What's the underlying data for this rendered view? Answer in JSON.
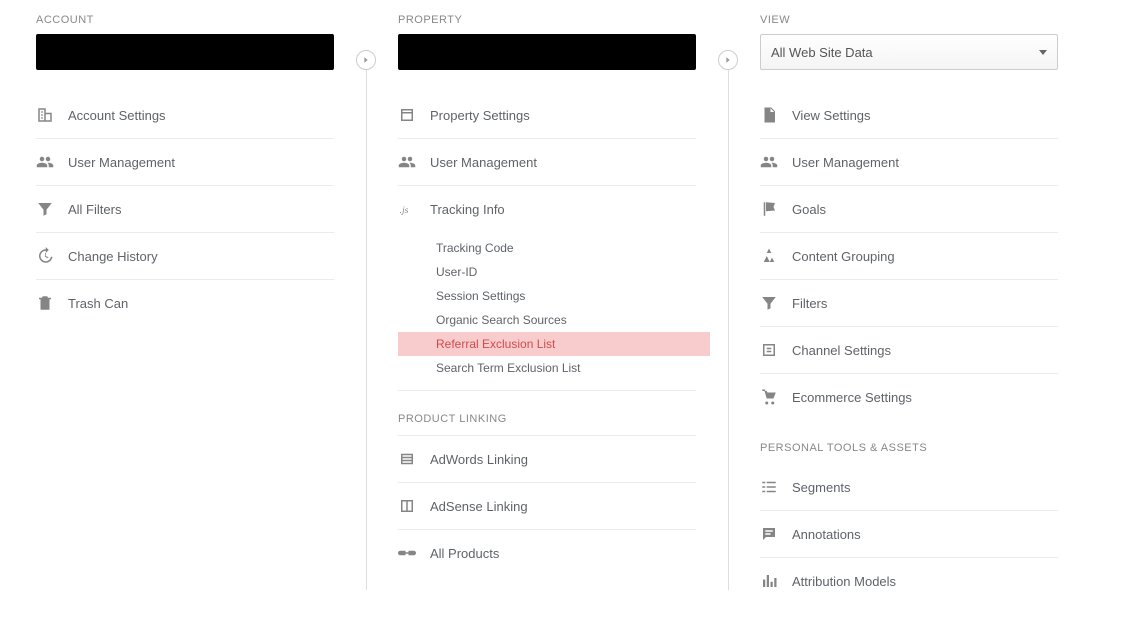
{
  "account": {
    "label": "ACCOUNT",
    "items": [
      {
        "id": "account-settings",
        "label": "Account Settings"
      },
      {
        "id": "user-management",
        "label": "User Management"
      },
      {
        "id": "all-filters",
        "label": "All Filters"
      },
      {
        "id": "change-history",
        "label": "Change History"
      },
      {
        "id": "trash-can",
        "label": "Trash Can"
      }
    ]
  },
  "property": {
    "label": "PROPERTY",
    "items": [
      {
        "id": "property-settings",
        "label": "Property Settings"
      },
      {
        "id": "user-management",
        "label": "User Management"
      },
      {
        "id": "tracking-info",
        "label": "Tracking Info"
      }
    ],
    "tracking_sub": [
      {
        "id": "tracking-code",
        "label": "Tracking Code"
      },
      {
        "id": "user-id",
        "label": "User-ID"
      },
      {
        "id": "session-settings",
        "label": "Session Settings"
      },
      {
        "id": "organic-search-sources",
        "label": "Organic Search Sources"
      },
      {
        "id": "referral-exclusion",
        "label": "Referral Exclusion List",
        "highlight": true
      },
      {
        "id": "search-term-exclusion",
        "label": "Search Term Exclusion List"
      }
    ],
    "section_product_linking": "PRODUCT LINKING",
    "product_linking": [
      {
        "id": "adwords-linking",
        "label": "AdWords Linking"
      },
      {
        "id": "adsense-linking",
        "label": "AdSense Linking"
      },
      {
        "id": "all-products",
        "label": "All Products"
      }
    ]
  },
  "view": {
    "label": "VIEW",
    "selector": "All Web Site Data",
    "items": [
      {
        "id": "view-settings",
        "label": "View Settings"
      },
      {
        "id": "user-management",
        "label": "User Management"
      },
      {
        "id": "goals",
        "label": "Goals"
      },
      {
        "id": "content-grouping",
        "label": "Content Grouping"
      },
      {
        "id": "filters",
        "label": "Filters"
      },
      {
        "id": "channel-settings",
        "label": "Channel Settings"
      },
      {
        "id": "ecommerce-settings",
        "label": "Ecommerce Settings"
      }
    ],
    "section_personal": "PERSONAL TOOLS & ASSETS",
    "personal": [
      {
        "id": "segments",
        "label": "Segments"
      },
      {
        "id": "annotations",
        "label": "Annotations"
      },
      {
        "id": "attribution-models",
        "label": "Attribution Models"
      }
    ]
  }
}
